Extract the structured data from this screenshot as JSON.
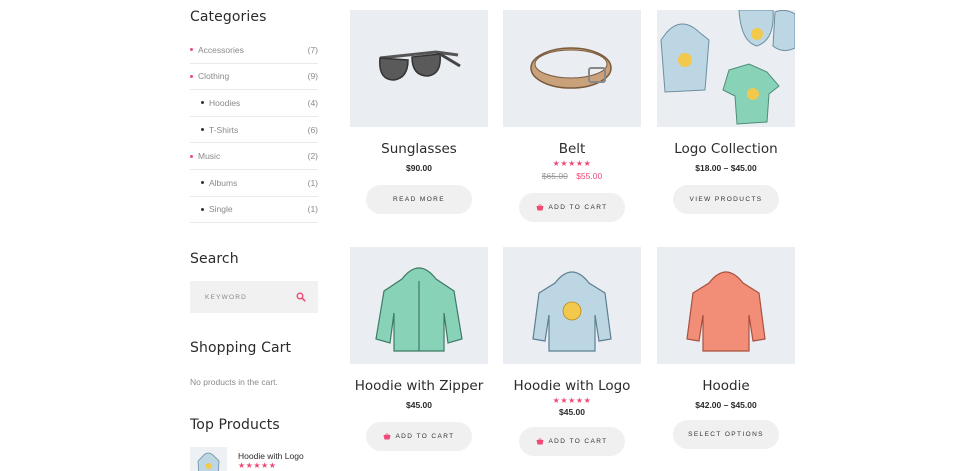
{
  "sidebar": {
    "categories_title": "Categories",
    "categories": [
      {
        "label": "Accessories",
        "count": "(7)",
        "child": false
      },
      {
        "label": "Clothing",
        "count": "(9)",
        "child": false
      },
      {
        "label": "Hoodies",
        "count": "(4)",
        "child": true
      },
      {
        "label": "T-Shirts",
        "count": "(6)",
        "child": true
      },
      {
        "label": "Music",
        "count": "(2)",
        "child": false
      },
      {
        "label": "Albums",
        "count": "(1)",
        "child": true
      },
      {
        "label": "Single",
        "count": "(1)",
        "child": true
      }
    ],
    "search_title": "Search",
    "search_placeholder": "KEYWORD",
    "cart_title": "Shopping Cart",
    "cart_empty": "No products in the cart.",
    "top_title": "Top Products",
    "top_product": {
      "name": "Hoodie with Logo",
      "stars": "★★★★★"
    }
  },
  "products": [
    {
      "name": "Sunglasses",
      "price": "$90.00",
      "stars": "",
      "old_price": "",
      "sale_price": "",
      "button": "READ MORE",
      "cart_icon": false
    },
    {
      "name": "Belt",
      "price": "",
      "stars": "★★★★★",
      "old_price": "$65.00",
      "sale_price": "$55.00",
      "button": "ADD TO CART",
      "cart_icon": true
    },
    {
      "name": "Logo Collection",
      "price": "$18.00 – $45.00",
      "stars": "",
      "old_price": "",
      "sale_price": "",
      "button": "VIEW PRODUCTS",
      "cart_icon": false
    },
    {
      "name": "Hoodie with Zipper",
      "price": "$45.00",
      "stars": "",
      "old_price": "",
      "sale_price": "",
      "button": "ADD TO CART",
      "cart_icon": true
    },
    {
      "name": "Hoodie with Logo",
      "price": "$45.00",
      "stars": "★★★★★",
      "old_price": "",
      "sale_price": "",
      "button": "ADD TO CART",
      "cart_icon": true
    },
    {
      "name": "Hoodie",
      "price": "$42.00 – $45.00",
      "stars": "",
      "old_price": "",
      "sale_price": "",
      "button": "SELECT OPTIONS",
      "cart_icon": false
    }
  ],
  "colors": {
    "accent": "#ef4a76",
    "thumb_bg": "#eaeef2",
    "button_bg": "#f0f0f0"
  }
}
